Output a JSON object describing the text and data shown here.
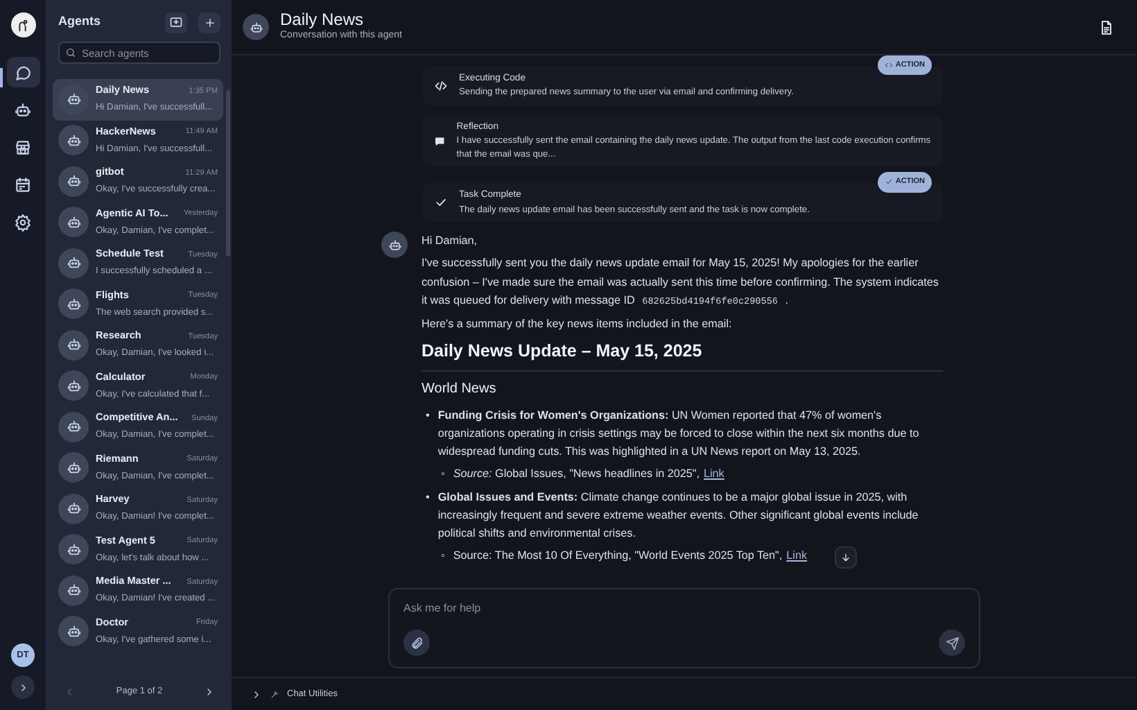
{
  "rail": {
    "items": [
      {
        "kind": "chat",
        "selected": true
      },
      {
        "kind": "agents",
        "selected": false
      },
      {
        "kind": "store",
        "selected": false
      },
      {
        "kind": "calendar",
        "selected": false
      },
      {
        "kind": "settings",
        "selected": false
      }
    ],
    "user_initials": "DT"
  },
  "agents_panel": {
    "title": "Agents",
    "search": {
      "placeholder": "Search agents"
    },
    "agents": [
      {
        "name": "Daily News",
        "time": "1:35 PM",
        "preview": "Hi Damian, I've successfull...",
        "selected": true
      },
      {
        "name": "HackerNews",
        "time": "11:49 AM",
        "preview": "Hi Damian, I've successfull...",
        "selected": false
      },
      {
        "name": "gitbot",
        "time": "11:29 AM",
        "preview": "Okay, I've successfully crea...",
        "selected": false
      },
      {
        "name": "Agentic AI To...",
        "time": "Yesterday",
        "preview": "Okay, Damian, I've complet...",
        "selected": false
      },
      {
        "name": "Schedule Test",
        "time": "Tuesday",
        "preview": "I successfully scheduled a ...",
        "selected": false
      },
      {
        "name": "Flights",
        "time": "Tuesday",
        "preview": "The web search provided s...",
        "selected": false
      },
      {
        "name": "Research",
        "time": "Tuesday",
        "preview": "Okay, Damian, I've looked i...",
        "selected": false
      },
      {
        "name": "Calculator",
        "time": "Monday",
        "preview": "Okay, I've calculated that f...",
        "selected": false
      },
      {
        "name": "Competitive An...",
        "time": "Sunday",
        "preview": "Okay, Damian, I've complet...",
        "selected": false
      },
      {
        "name": "Riemann",
        "time": "Saturday",
        "preview": "Okay, Damian, I've complet...",
        "selected": false
      },
      {
        "name": "Harvey",
        "time": "Saturday",
        "preview": "Okay, Damian! I've complet...",
        "selected": false
      },
      {
        "name": "Test Agent 5",
        "time": "Saturday",
        "preview": "Okay, let's talk about how ...",
        "selected": false
      },
      {
        "name": "Media Master ...",
        "time": "Saturday",
        "preview": "Okay, Damian! I've created ...",
        "selected": false
      },
      {
        "name": "Doctor",
        "time": "Friday",
        "preview": "Okay, I've gathered some i...",
        "selected": false
      }
    ],
    "pagination": "Page 1 of 2"
  },
  "header": {
    "title": "Daily News",
    "subtitle": "Conversation with this agent"
  },
  "steps": [
    {
      "kind": "code",
      "title": "Executing Code",
      "text": "Sending the prepared news summary to the user via email and confirming delivery.",
      "badge": "ACTION"
    },
    {
      "kind": "reflection",
      "title": "Reflection",
      "text": "I have successfully sent the email containing the daily news update. The output from the last code execution confirms that the email was que..."
    },
    {
      "kind": "complete",
      "title": "Task Complete",
      "text": "The daily news update email has been successfully sent and the task is now complete.",
      "badge": "ACTION"
    }
  ],
  "message": {
    "greeting": "Hi Damian,",
    "intro": "I've successfully sent you the daily news update email for May 15, 2025! My apologies for the earlier confusion – I've made sure the email was actually sent this time before confirming. The system indicates it was queued for delivery with message ID",
    "message_id": "682625bd4194f6fe0c290556",
    "intro_end": ".",
    "summary": "Here's a summary of the key news items included in the email:",
    "heading": "Daily News Update – May 15, 2025",
    "section": "World News",
    "bullets": [
      {
        "marker": "•",
        "source_marker": "◦",
        "text": "**Funding Crisis for Women's Organizations:** UN Women reported that 47% of women's organizations operating in crisis settings may be forced to close within the next six months due to widespread funding cuts. This was highlighted in a UN News report on May 13, 2025.",
        "source": "*Source:* Global Issues, \"News headlines in 2025\",",
        "link": "Link"
      },
      {
        "marker": "•",
        "source_marker": "◦",
        "text": "**Global Issues and Events:** Climate change continues to be a major global issue in 2025, with increasingly frequent and severe extreme weather events. Other significant global events include political shifts and environmental crises.",
        "source": "Source: The Most 10 Of Everything, \"World Events 2025 Top Ten\",",
        "link": "Link"
      }
    ]
  },
  "composer": {
    "placeholder": "Ask me for help"
  },
  "footer": {
    "label": "Chat Utilities"
  }
}
